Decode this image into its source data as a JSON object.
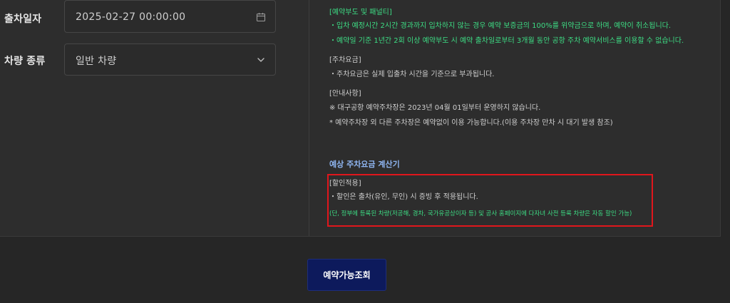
{
  "form": {
    "departure": {
      "label": "출차일자",
      "value": "2025-02-27 00:00:00",
      "icon": "calendar-icon"
    },
    "vehicle": {
      "label": "차량 종류",
      "value": "일반 차량",
      "icon": "chevron-down-icon"
    }
  },
  "notices": {
    "penalty_title": "[예약부도 및 패널티]",
    "penalty_1": "・입차 예정시간 2시간 경과까지 입차하지 않는 경우 예약 보증금의 100%를 위약금으로 하며, 예약이 취소됩니다.",
    "penalty_2": "・예약일 기준 1년간 2회 이상 예약부도 시 예약 출차일로부터 3개월 동안 공항 주차 예약서비스를 이용할 수 없습니다.",
    "fee_title": "[주차요금]",
    "fee_1": "・주차요금은 실제 입출차 시간을 기준으로 부과됩니다.",
    "guide_title": "[안내사항]",
    "guide_1": "※ 대구공항 예약주차장은 2023년 04월 01일부터 운영하지 않습니다.",
    "guide_2": "* 예약주차장 외 다른 주차장은 예약없이 이용 가능합니다.(이용 주차장 만차 시 대기 발생 참조)"
  },
  "calculator": {
    "title": "예상 주차요금 계산기",
    "discount_title": "[할인적용]",
    "discount_1": "・할인은 출차(유인, 무인) 시 증빙 후 적용됩니다.",
    "discount_2": "(단, 정부에 등록된 차량(저공해, 경차, 국가유공상이자 등) 및 공사 홈페이지에 다자녀 사전 등록 차량은 자동 할인 가능)"
  },
  "actions": {
    "submit_label": "예약가능조회"
  },
  "colors": {
    "accent_green": "#3ddc84",
    "highlight_red": "#e0161c",
    "button_navy": "#0d1a5c",
    "title_blue": "#8fb6f2"
  }
}
